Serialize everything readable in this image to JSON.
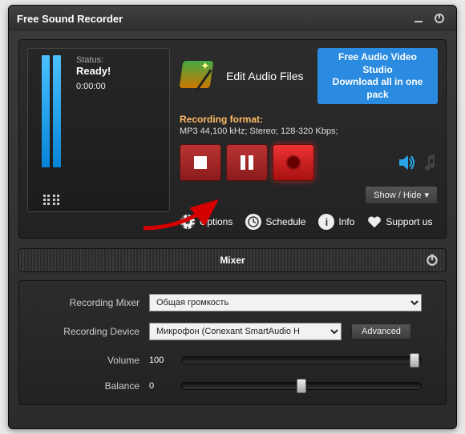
{
  "title": "Free Sound Recorder",
  "status": {
    "label": "Status:",
    "value": "Ready!",
    "time": "0:00:00"
  },
  "edit_label": "Edit Audio Files",
  "banner": {
    "l1": "Free Audio Video Studio",
    "l2": "Download all in one pack"
  },
  "format": {
    "header": "Recording format:",
    "detail": "MP3 44,100 kHz; Stereo;  128-320 Kbps;"
  },
  "showhide": "Show / Hide",
  "links": {
    "options": "Options",
    "schedule": "Schedule",
    "info": "Info",
    "support": "Support us"
  },
  "mixer": {
    "title": "Mixer",
    "rec_mixer_label": "Recording Mixer",
    "rec_mixer_value": "Общая громкость",
    "rec_device_label": "Recording Device",
    "rec_device_value": "Микрофон (Conexant SmartAudio H",
    "advanced": "Advanced",
    "volume_label": "Volume",
    "volume_value": "100",
    "balance_label": "Balance",
    "balance_value": "0"
  }
}
